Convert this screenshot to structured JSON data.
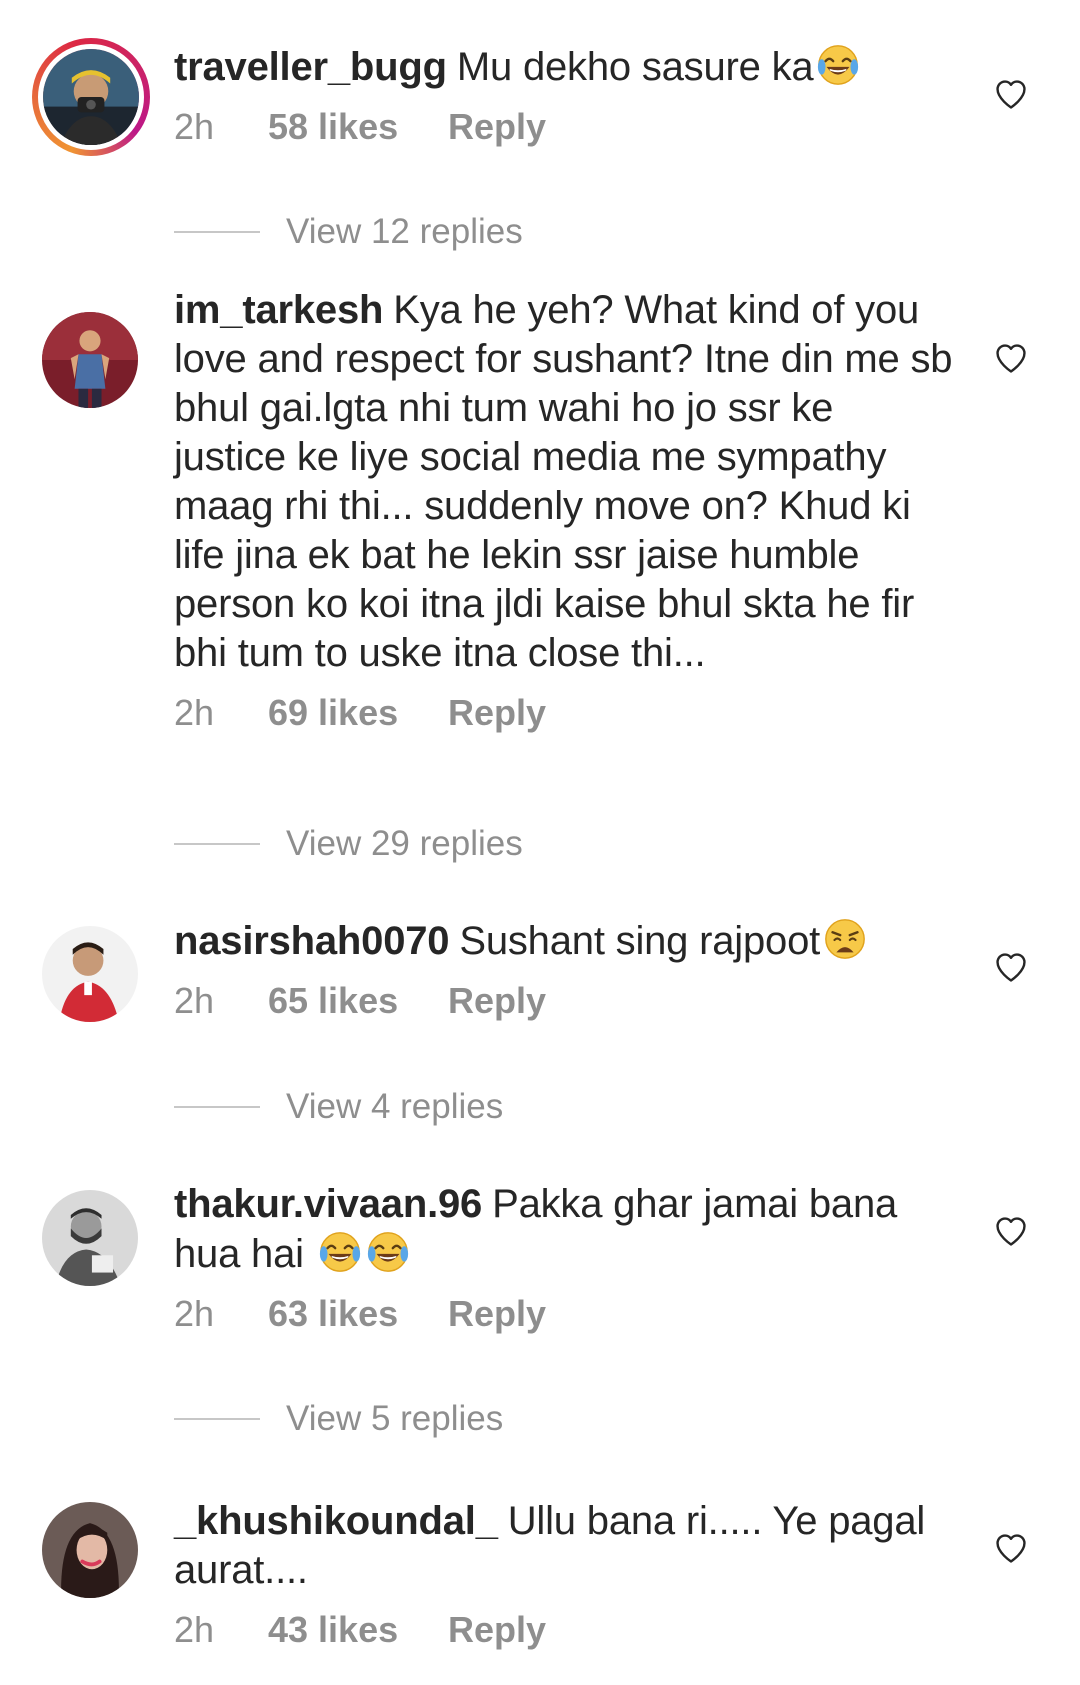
{
  "comments": [
    {
      "username": "traveller_bugg",
      "text": "Mu dekho sasure ka",
      "emoji": [
        "tears-of-joy"
      ],
      "time": "2h",
      "likes": "58 likes",
      "reply": "Reply",
      "view_replies": "View 12 replies"
    },
    {
      "username": "im_tarkesh",
      "text": "Kya he yeh? What kind of you love and respect for sushant? Itne din me sb bhul gai.lgta nhi tum wahi ho jo ssr ke justice ke liye social media me sympathy maag rhi thi... suddenly move on? Khud ki life jina ek bat he lekin ssr jaise humble person ko koi itna jldi kaise bhul skta he fir bhi tum to uske itna close thi...",
      "emoji": [],
      "time": "2h",
      "likes": "69 likes",
      "reply": "Reply",
      "view_replies": "View 29 replies"
    },
    {
      "username": "nasirshah0070",
      "text": "Sushant sing rajpoot",
      "emoji": [
        "weary-face"
      ],
      "time": "2h",
      "likes": "65 likes",
      "reply": "Reply",
      "view_replies": "View 4 replies"
    },
    {
      "username": "thakur.vivaan.96",
      "text": "Pakka ghar jamai bana hua hai ",
      "emoji": [
        "tears-of-joy",
        "tears-of-joy"
      ],
      "time": "2h",
      "likes": "63 likes",
      "reply": "Reply",
      "view_replies": "View 5 replies"
    },
    {
      "username": "_khushikoundal_",
      "text": "Ullu bana ri..... Ye pagal aurat....",
      "emoji": [],
      "time": "2h",
      "likes": "43 likes",
      "reply": "Reply"
    }
  ],
  "icons": {
    "like": "heart-outline-icon"
  },
  "colors": {
    "text": "#262626",
    "secondary": "#8e8e8e",
    "story_ring": "#dc2743"
  }
}
